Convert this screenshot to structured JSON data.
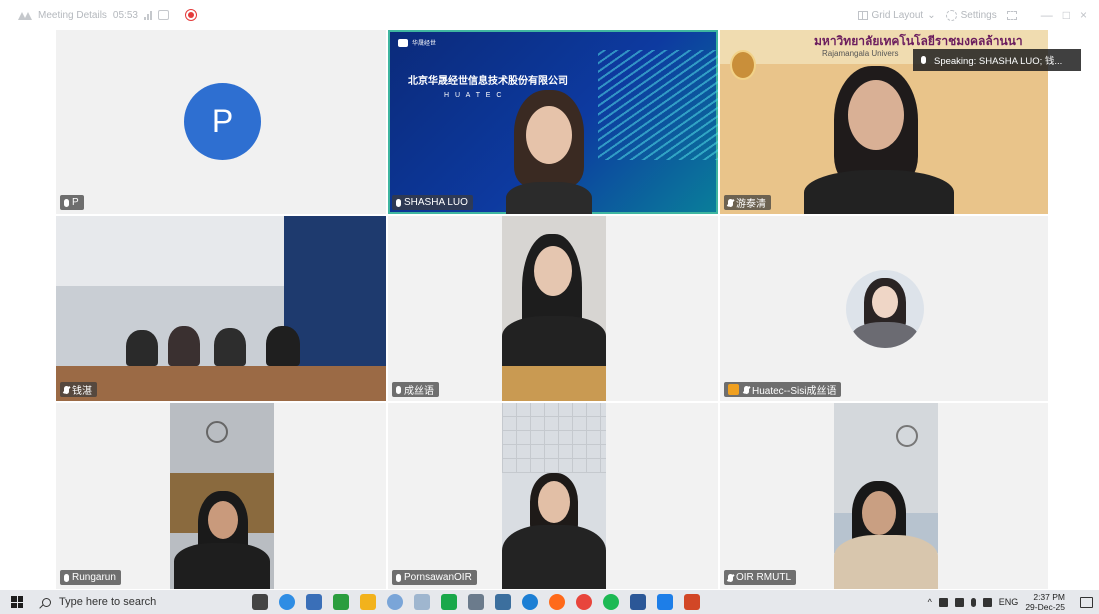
{
  "titlebar": {
    "title": "Meeting Details",
    "duration": "05:53",
    "layout_label": "Grid Layout",
    "settings_label": "Settings",
    "window_controls": {
      "minimize": "—",
      "restore": "□",
      "close": "×"
    }
  },
  "speaking": {
    "text": "Speaking:  SHASHA LUO; 钱..."
  },
  "participants": [
    {
      "name": "P",
      "avatar_letter": "P",
      "mic": "speaker"
    },
    {
      "name": "SHASHA LUO",
      "mic": "on",
      "active": true,
      "banner_text": "北京华晟经世信息技术股份有限公司",
      "banner_sub": "H U A T E C",
      "brand": "华晟经世"
    },
    {
      "name": "游泰清",
      "mic": "muted",
      "banner_text": "มหาวิทยาลัยเทคโนโลยีราชมงคลล้านนา",
      "banner_sub": "Rajamangala Univers"
    },
    {
      "name": "钱湛",
      "mic": "muted"
    },
    {
      "name": "成丝语",
      "mic": "speaker"
    },
    {
      "name": "Huatec--Sisi成丝语",
      "mic": "muted",
      "host": true
    },
    {
      "name": "Rungarun",
      "mic": "speaker"
    },
    {
      "name": "PornsawanOIR",
      "mic": "speaker"
    },
    {
      "name": "OIR RMUTL",
      "mic": "muted"
    }
  ],
  "taskbar": {
    "search_placeholder": "Type here to search",
    "language": "ENG",
    "time": "2:37 PM",
    "date": "29-Dec-25"
  },
  "colors": {
    "active_border": "#3fb6a0",
    "avatar_blue": "#2e6fd1",
    "record_red": "#e43b3b"
  }
}
